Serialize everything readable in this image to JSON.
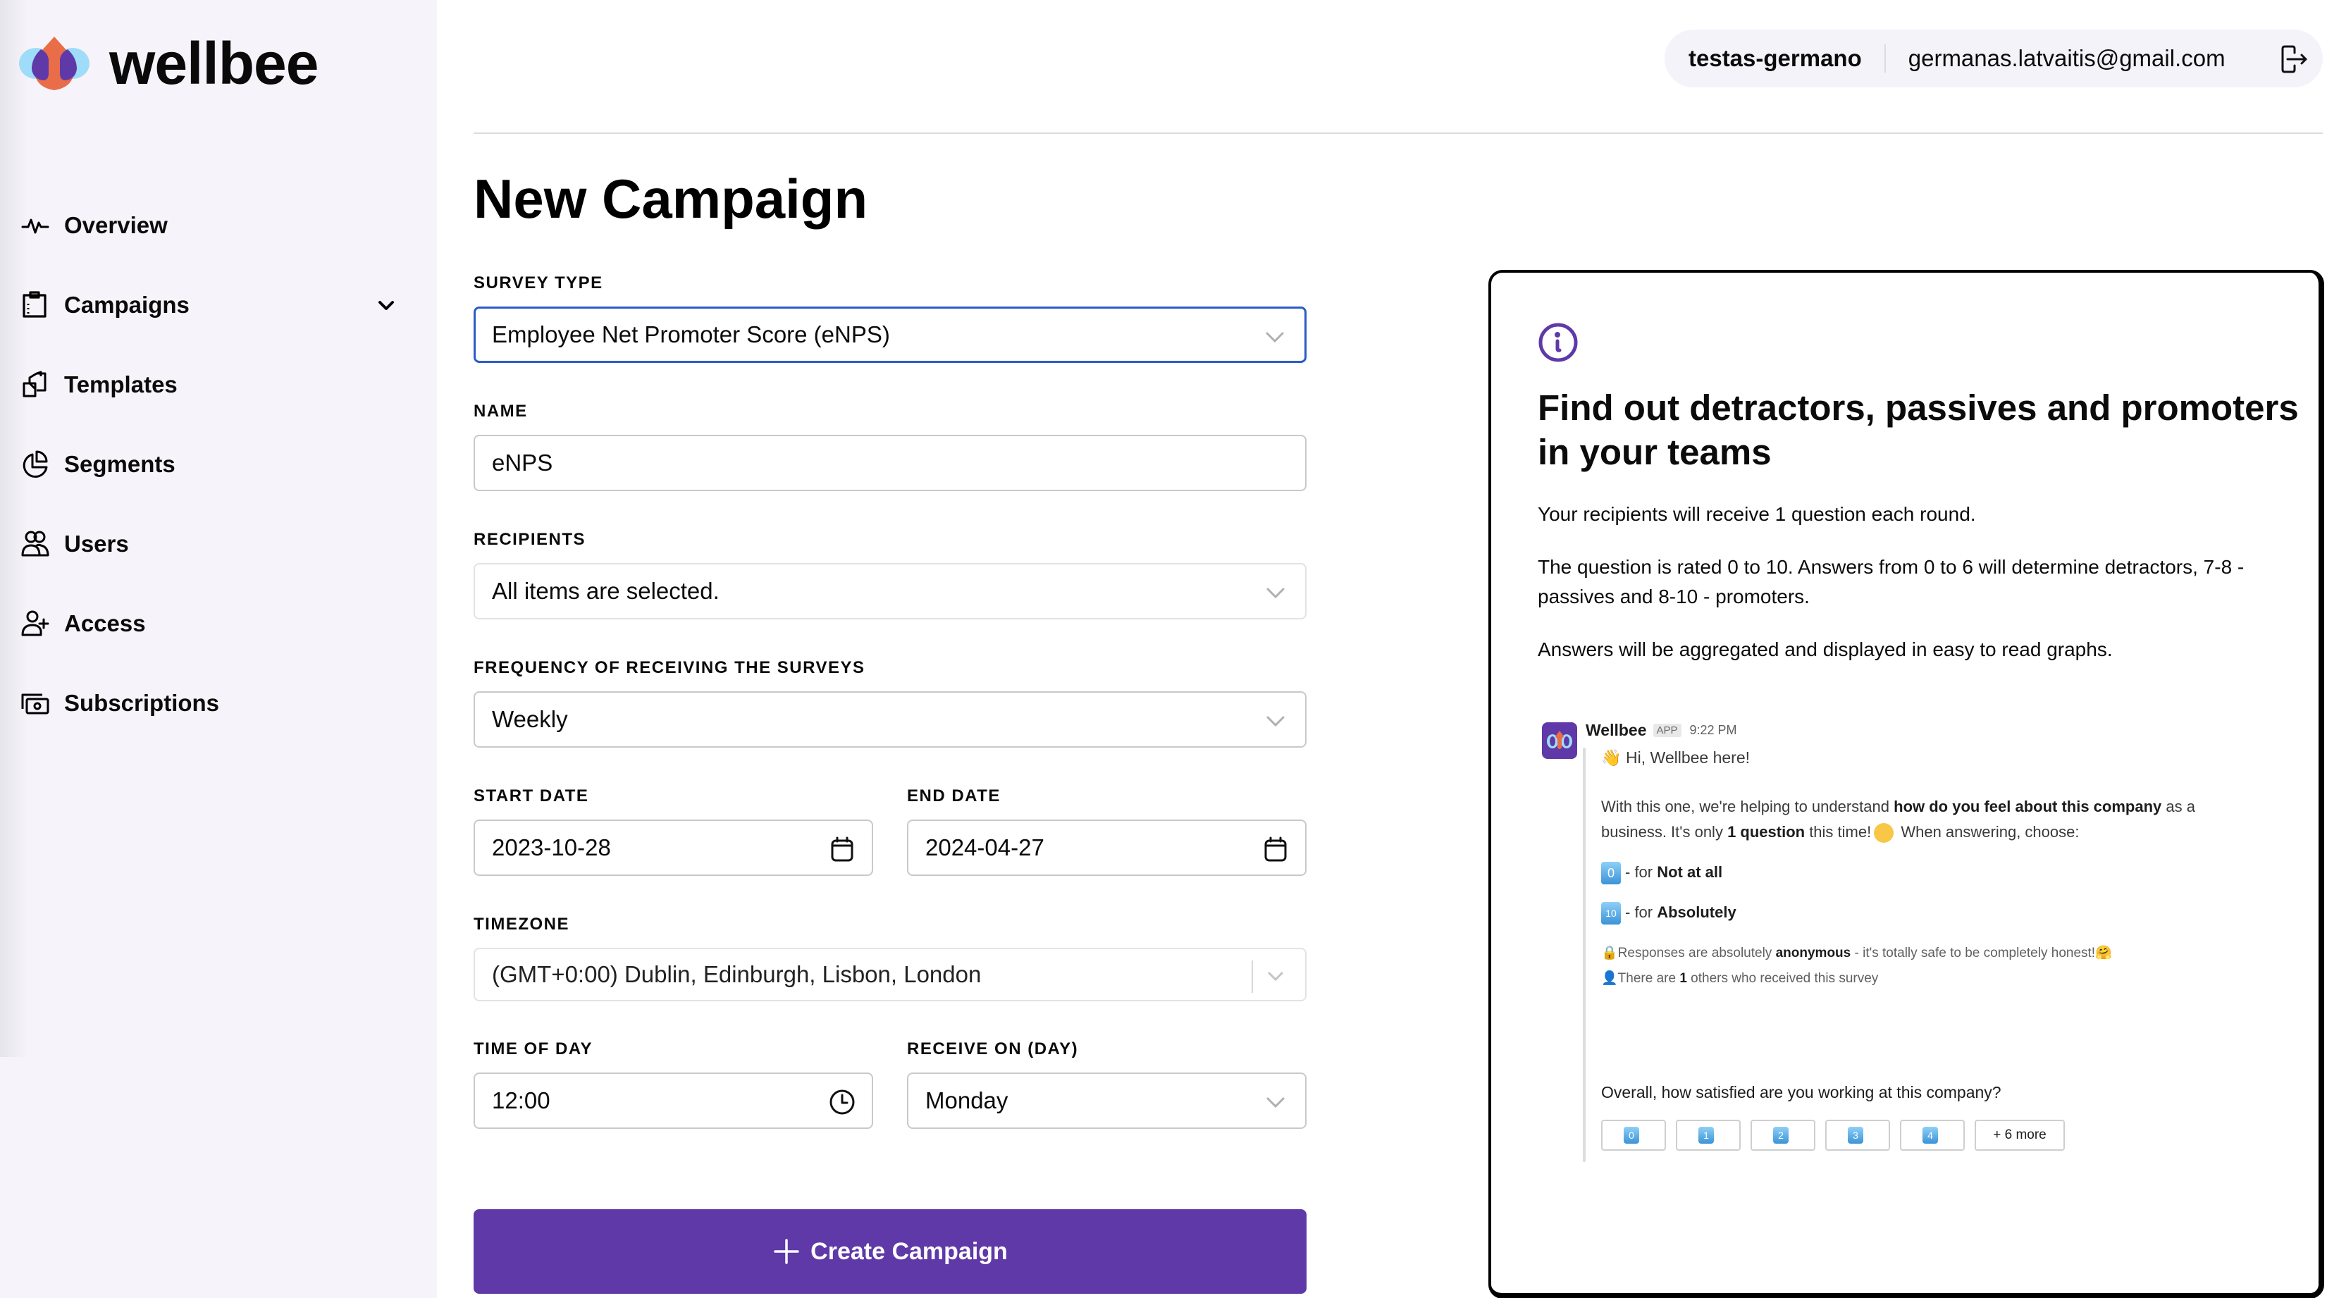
{
  "app": {
    "name": "wellbee"
  },
  "sidebar": {
    "items": [
      {
        "label": "Overview",
        "icon": "activity-icon"
      },
      {
        "label": "Campaigns",
        "icon": "clipboard-icon",
        "expandable": true
      },
      {
        "label": "Templates",
        "icon": "templates-icon"
      },
      {
        "label": "Segments",
        "icon": "pie-chart-icon"
      },
      {
        "label": "Users",
        "icon": "users-icon"
      },
      {
        "label": "Access",
        "icon": "user-plus-icon"
      },
      {
        "label": "Subscriptions",
        "icon": "money-icon"
      }
    ]
  },
  "header": {
    "organization": "testas-germano",
    "email": "germanas.latvaitis@gmail.com",
    "logout_icon": "logout-icon"
  },
  "page": {
    "title": "New Campaign"
  },
  "form": {
    "survey_type": {
      "label": "SURVEY TYPE",
      "value": "Employee Net Promoter Score (eNPS)"
    },
    "name": {
      "label": "NAME",
      "value": "eNPS"
    },
    "recipients": {
      "label": "RECIPIENTS",
      "value": "All items are selected."
    },
    "frequency": {
      "label": "FREQUENCY OF RECEIVING THE SURVEYS",
      "value": "Weekly"
    },
    "start_date": {
      "label": "START DATE",
      "value": "2023-10-28"
    },
    "end_date": {
      "label": "END DATE",
      "value": "2024-04-27"
    },
    "timezone": {
      "label": "TIMEZONE",
      "value": "(GMT+0:00) Dublin, Edinburgh, Lisbon, London"
    },
    "time_of_day": {
      "label": "TIME OF DAY",
      "value": "12:00"
    },
    "receive_on": {
      "label": "RECEIVE ON (DAY)",
      "value": "Monday"
    },
    "submit_label": "Create Campaign"
  },
  "info": {
    "title": "Find out detractors, passives and promoters in your teams",
    "paragraphs": [
      "Your recipients will receive 1 question each round.",
      "The question is rated 0 to 10. Answers from 0 to 6 will determine detractors, 7-8 - passives and 8-10 - promoters.",
      "Answers will be aggregated and displayed in easy to read graphs."
    ],
    "preview": {
      "sender": "Wellbee",
      "badge": "APP",
      "time": "9:22 PM",
      "greeting": "Hi, Wellbee here!",
      "intro_prefix": "With this one, we're helping to understand ",
      "intro_bold": "how do you feel about this company",
      "intro_suffix": " as a",
      "intro2_prefix": "business. It's only ",
      "intro2_bold": "1 question",
      "intro2_mid": " this time!",
      "intro2_suffix": " When answering, choose:",
      "option_low_key": "0",
      "option_low_prefix": "- for ",
      "option_low_bold": "Not at all",
      "option_high_key": "10",
      "option_high_prefix": "- for ",
      "option_high_bold": "Absolutely",
      "anon_prefix": "Responses are absolutely ",
      "anon_bold": "anonymous",
      "anon_suffix": " - it's totally safe to be completely honest!",
      "others_prefix": "There are ",
      "others_bold": "1",
      "others_suffix": " others who received this survey",
      "question": "Overall, how satisfied are you working at this company?",
      "buttons": [
        "0",
        "1",
        "2",
        "3",
        "4"
      ],
      "more_label": "+ 6 more"
    }
  },
  "colors": {
    "accent": "#5f39a8",
    "focus": "#2a5cc6",
    "sidebar_bg": "#f6f4fa"
  }
}
